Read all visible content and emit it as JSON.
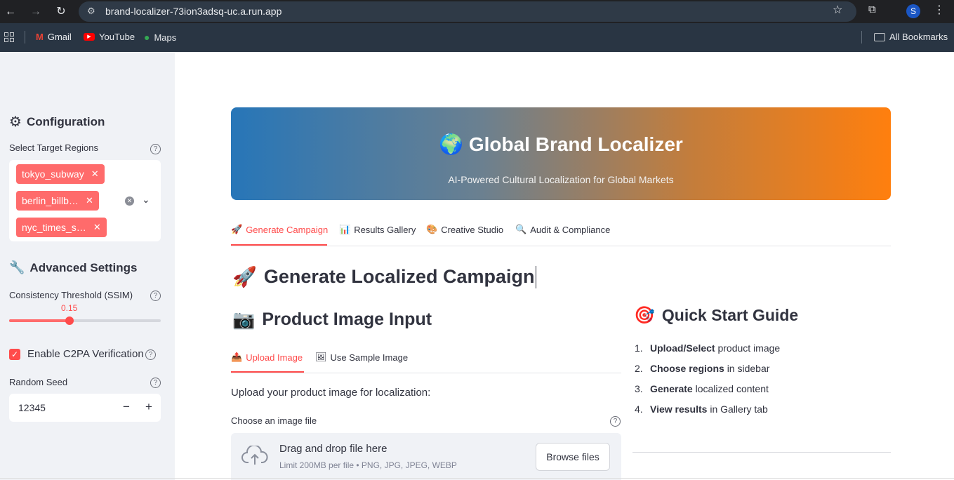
{
  "browser": {
    "url": "brand-localizer-73ion3adsq-uc.a.run.app",
    "profile_initial": "S",
    "bookmarks": [
      "Gmail",
      "YouTube",
      "Maps"
    ],
    "all_bookmarks": "All Bookmarks"
  },
  "sidebar": {
    "config_title": "Configuration",
    "regions_label": "Select Target Regions",
    "regions": [
      "tokyo_subway",
      "berlin_billb…",
      "nyc_times_s…"
    ],
    "advanced_title": "Advanced Settings",
    "ssim_label": "Consistency Threshold (SSIM)",
    "ssim_value": "0.15",
    "ssim_fraction": 0.4,
    "c2pa_label": "Enable C2PA Verification",
    "c2pa_checked": true,
    "seed_label": "Random Seed",
    "seed_value": "12345",
    "seed_minus": "−",
    "seed_plus": "+"
  },
  "hero": {
    "title": "Global Brand Localizer",
    "subtitle": "AI-Powered Cultural Localization for Global Markets",
    "gradient_start": "#2776b8",
    "gradient_end": "#ff7f0e"
  },
  "tabs": [
    {
      "label": "Generate Campaign",
      "icon": "rocket-icon",
      "active": true
    },
    {
      "label": "Results Gallery",
      "icon": "bar-chart-icon",
      "active": false
    },
    {
      "label": "Creative Studio",
      "icon": "palette-icon",
      "active": false
    },
    {
      "label": "Audit & Compliance",
      "icon": "magnifier-icon",
      "active": false
    }
  ],
  "main": {
    "heading": "Generate Localized Campaign",
    "input_heading": "Product Image Input",
    "subtabs": [
      "Upload Image",
      "Use Sample Image"
    ],
    "upload_prompt": "Upload your product image for localization:",
    "file_label": "Choose an image file",
    "dropzone_title": "Drag and drop file here",
    "dropzone_sub": "Limit 200MB per file • PNG, JPG, JPEG, WEBP",
    "browse_label": "Browse files"
  },
  "guide": {
    "heading": "Quick Start Guide",
    "steps": [
      {
        "num": "1.",
        "bold": "Upload/Select",
        "rest": "product image"
      },
      {
        "num": "2.",
        "bold": "Choose regions",
        "rest": "in sidebar"
      },
      {
        "num": "3.",
        "bold": "Generate",
        "rest": "localized content"
      },
      {
        "num": "4.",
        "bold": "View results",
        "rest": "in Gallery tab"
      }
    ]
  },
  "colors": {
    "accent": "#ff4b4b",
    "chip": "#ff6b6b",
    "sidebar_bg": "#f0f2f6"
  }
}
